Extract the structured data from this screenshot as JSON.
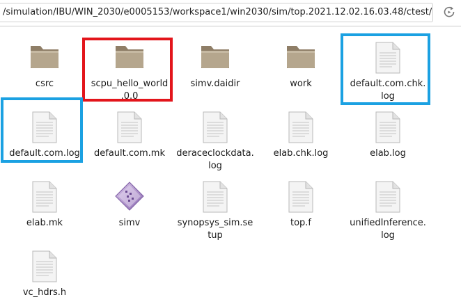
{
  "address_bar": {
    "path": "/simulation/IBU/WIN_2030/e0005153/workspace1/win2030/sim/top.2021.12.02.16.03.48/ctest/",
    "reload_icon": "reload-icon"
  },
  "files": [
    {
      "name": "csrc",
      "kind": "folder"
    },
    {
      "name": "scpu_hello_world\n.0.0",
      "kind": "folder"
    },
    {
      "name": "simv.daidir",
      "kind": "folder"
    },
    {
      "name": "work",
      "kind": "folder"
    },
    {
      "name": "default.com.chk.\nlog",
      "kind": "text"
    },
    {
      "name": "default.com.log",
      "kind": "text"
    },
    {
      "name": "default.com.mk",
      "kind": "text"
    },
    {
      "name": "deraceclockdata.\nlog",
      "kind": "text"
    },
    {
      "name": "elab.chk.log",
      "kind": "text"
    },
    {
      "name": "elab.log",
      "kind": "text"
    },
    {
      "name": "elab.mk",
      "kind": "text"
    },
    {
      "name": "simv",
      "kind": "executable"
    },
    {
      "name": "synopsys_sim.se\ntup",
      "kind": "text"
    },
    {
      "name": "top.f",
      "kind": "text"
    },
    {
      "name": "unifiedInference.\nlog",
      "kind": "text"
    },
    {
      "name": "vc_hdrs.h",
      "kind": "text"
    }
  ],
  "highlight_colors": {
    "red": "#e3151b",
    "blue": "#1ba1e2"
  }
}
